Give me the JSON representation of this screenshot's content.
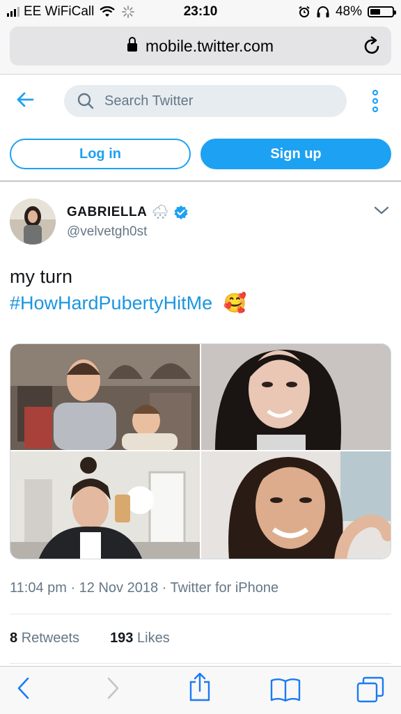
{
  "status_bar": {
    "carrier": "EE WiFiCall",
    "time": "23:10",
    "battery": "48%",
    "battery_level": 0.48
  },
  "browser": {
    "url": "mobile.twitter.com"
  },
  "header": {
    "search_placeholder": "Search Twitter",
    "login_label": "Log in",
    "signup_label": "Sign up"
  },
  "tweet": {
    "display_name": "GABRIELLA",
    "name_emoji": "🌨",
    "handle": "@velvetgh0st",
    "text_line1": "my turn",
    "hashtag": "#HowHardPubertyHitMe",
    "text_emoji": "🥰",
    "timestamp": "11:04 pm · 12 Nov 2018 · Twitter for iPhone",
    "retweets_count": "8",
    "retweets_label": "Retweets",
    "likes_count": "193",
    "likes_label": "Likes"
  },
  "icons": {
    "back": "arrow-left-icon",
    "search": "search-icon",
    "more": "kebab-icon",
    "verified": "verified-badge-icon",
    "caret": "chevron-down-icon",
    "share": "share-icon",
    "bookmarks": "bookmarks-icon",
    "tabs": "tabs-icon"
  },
  "colors": {
    "brand_blue": "#1da1f2",
    "link_blue": "#1b95e0",
    "secondary_text": "#657786"
  }
}
